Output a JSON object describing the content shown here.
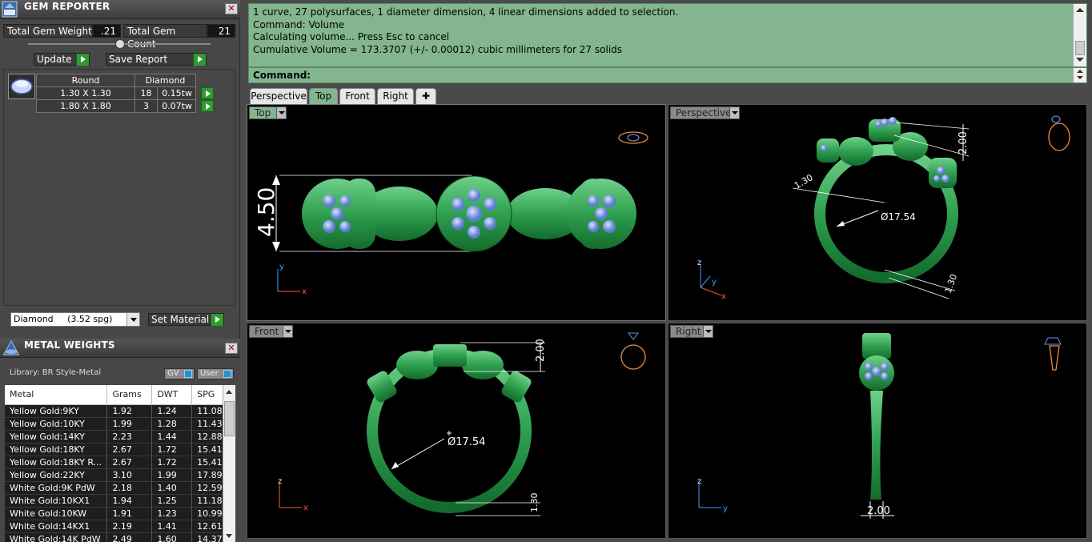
{
  "gem_reporter": {
    "title": "GEM REPORTER",
    "total_weight_label": "Total Gem Weight",
    "total_weight_value": ".21",
    "total_count_label": "Total Gem Count",
    "total_count_value": "21",
    "update_label": "Update",
    "save_report_label": "Save Report",
    "table": {
      "headers": [
        "Round",
        "Diamond"
      ],
      "rows": [
        {
          "size": "1.30 X 1.30",
          "count": "18",
          "weight": "0.15tw"
        },
        {
          "size": "1.80 X 1.80",
          "count": "3",
          "weight": "0.07tw"
        }
      ]
    },
    "material_select": "Diamond     (3.52 spg)",
    "set_material_label": "Set Material"
  },
  "metal_weights": {
    "title": "METAL WEIGHTS",
    "library": "Library: BR Style-Metal",
    "gv_label": "GV",
    "user_label": "User",
    "columns": [
      "Metal",
      "Grams",
      "DWT",
      "SPG"
    ],
    "rows": [
      [
        "Yellow Gold:9KY",
        "1.92",
        "1.24",
        "11.08"
      ],
      [
        "Yellow Gold:10KY",
        "1.99",
        "1.28",
        "11.43"
      ],
      [
        "Yellow Gold:14KY",
        "2.23",
        "1.44",
        "12.88"
      ],
      [
        "Yellow Gold:18KY",
        "2.67",
        "1.72",
        "15.41"
      ],
      [
        "Yellow Gold:18KY R...",
        "2.67",
        "1.72",
        "15.41"
      ],
      [
        "Yellow Gold:22KY",
        "3.10",
        "1.99",
        "17.89"
      ],
      [
        "White Gold:9K PdW",
        "2.18",
        "1.40",
        "12.59"
      ],
      [
        "White Gold:10KX1",
        "1.94",
        "1.25",
        "11.18"
      ],
      [
        "White Gold:10KW",
        "1.91",
        "1.23",
        "10.99"
      ],
      [
        "White Gold:14KX1",
        "2.19",
        "1.41",
        "12.61"
      ],
      [
        "White Gold:14K PdW",
        "2.49",
        "1.60",
        "14.37"
      ]
    ]
  },
  "command": {
    "history": [
      "1 curve, 27 polysurfaces, 1 diameter dimension, 4 linear dimensions added to selection.",
      "Command: Volume",
      "Calculating volume... Press Esc to cancel",
      "Cumulative Volume = 173.3707 (+/- 0.00012) cubic millimeters for 27 solids"
    ],
    "prompt": "Command:"
  },
  "tabs": [
    "Perspective",
    "Top",
    "Front",
    "Right"
  ],
  "viewports": {
    "top": {
      "label": "Top",
      "dim": "4.50"
    },
    "perspective": {
      "label": "Perspective",
      "dim_a": "2.00",
      "dim_b": "1.30",
      "dim_diam": "Ø17.54",
      "dim_c": "1.30"
    },
    "front": {
      "label": "Front",
      "dim_a": "2.00",
      "dim_diam": "Ø17.54",
      "dim_c": "1.30"
    },
    "right": {
      "label": "Right",
      "dim": "2.00"
    }
  },
  "colors": {
    "accent": "#83b68e",
    "ring": "#2fa04f",
    "gem": "#8aa6e8"
  }
}
